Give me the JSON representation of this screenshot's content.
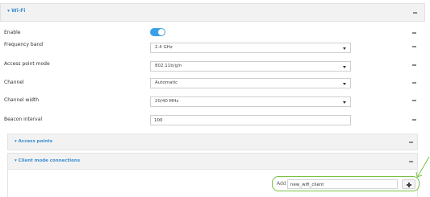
{
  "wifi": {
    "title": "▾ Wi-Fi",
    "collapse_icon": "minus-icon"
  },
  "fields": {
    "enable": {
      "label": "Enable",
      "value": true
    },
    "frequency_band": {
      "label": "Frequency band",
      "value": "2.4 GHz"
    },
    "access_point_mode": {
      "label": "Access point mode",
      "value": "802.11b/g/n"
    },
    "channel": {
      "label": "Channel",
      "value": "Automatic"
    },
    "channel_width": {
      "label": "Channel width",
      "value": "20/40 MHz"
    },
    "beacon_interval": {
      "label": "Beacon interval",
      "value": "100"
    }
  },
  "access_points": {
    "title": "▾ Access points"
  },
  "client_mode": {
    "title": "▾ Client mode connections",
    "add_label": "Add",
    "add_value": "new_wifi_client",
    "add_button_icon": "plus-icon"
  },
  "colors": {
    "link_blue": "#3b8ed1",
    "toggle_on": "#3aa0e8",
    "highlight_green": "#7ac143"
  }
}
